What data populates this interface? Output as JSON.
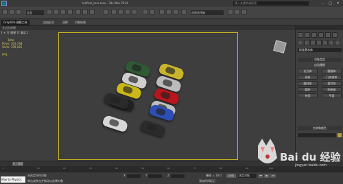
{
  "window": {
    "title": "lanfirst_cars.max - 3ds Max 2014",
    "search_placeholder": "键入关键字或短语",
    "min": "–",
    "max": "□",
    "close": "✕"
  },
  "toolbar": {
    "selection_filter": "全部",
    "reference_coord": "创建选择集"
  },
  "ribbon": {
    "tabs": [
      "Graphite 建模工具",
      "自由形式",
      "选择",
      "对象绘制"
    ],
    "sub": "多边形建模"
  },
  "viewport": {
    "label": "[ + ] [ 透视 ] [ 真实 ]",
    "stats_title": "Total",
    "polys": "Polys:  303,748",
    "verts": "Verts:  199,026",
    "fps": "FPS:"
  },
  "command_panel": {
    "category": "标准基本体",
    "section_object_type": "对象类型",
    "autogrid": "自动栅格",
    "buttons": [
      "长方体",
      "圆锥体",
      "球体",
      "几何球体",
      "圆柱体",
      "管状体",
      "圆环",
      "四棱锥",
      "茶壶",
      "平面"
    ],
    "section_name_color": "名称和颜色"
  },
  "timeline": {
    "thumb": "0 / 100",
    "ticks": [
      "0",
      "10",
      "20",
      "30",
      "40",
      "50",
      "60",
      "70",
      "80",
      "90",
      "100"
    ]
  },
  "statusbar": {
    "maxscript": "Max to Physics",
    "line1": "未选定任何对象",
    "line2": "单击或单击并拖动以选择对象",
    "x_label": "X:",
    "y_label": "Y:",
    "z_label": "Z:",
    "grid": "栅格 = 10.0",
    "add_time_tag": "添加时间标记",
    "autokey": "自动",
    "selected": "选定对象"
  },
  "watermark": {
    "brand": "Bai du 经验",
    "url": "jingyan.baidu.com"
  },
  "cars": [
    {
      "color": "#2f5a34"
    },
    {
      "color": "#c9b52c"
    },
    {
      "color": "#cfcfcf"
    },
    {
      "color": "#bcbcbc"
    },
    {
      "color": "#c8b818"
    },
    {
      "color": "#b8161c"
    },
    {
      "color": "#222222"
    },
    {
      "color": "#bfbfbf"
    },
    {
      "color": "#2a2a2a"
    },
    {
      "color": "#2d4fb5"
    },
    {
      "color": "#d6d6d6"
    },
    {
      "color": "#2b2b2b"
    }
  ]
}
